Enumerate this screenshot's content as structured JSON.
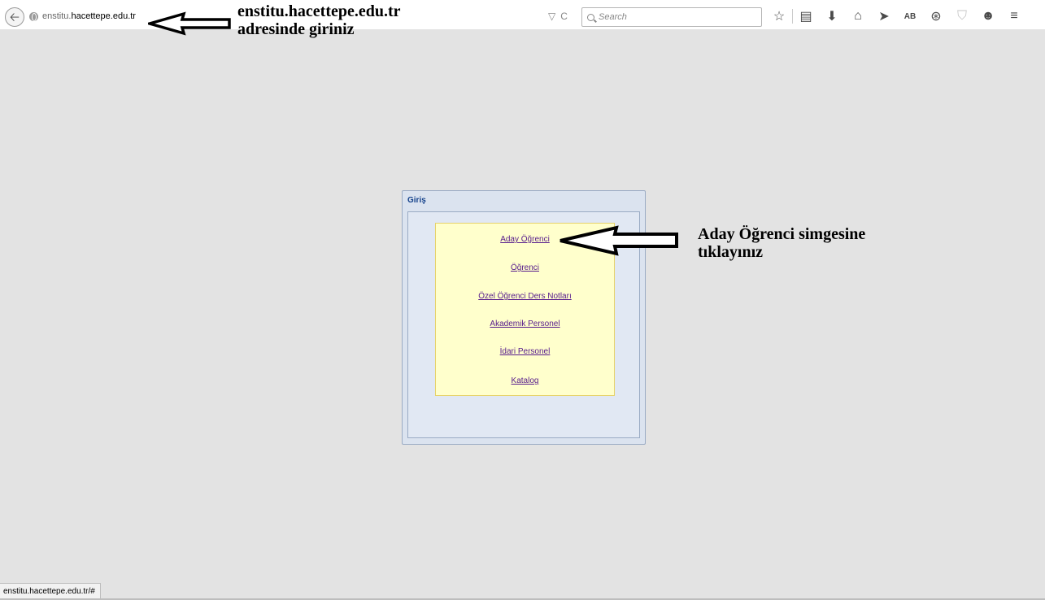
{
  "browser": {
    "url_prefix": "enstitu.",
    "url_host": "hacettepe.edu.tr",
    "search_placeholder": "Search",
    "reader_glyph": "▽",
    "reload_glyph": "C",
    "toolbar_icons": [
      "star-icon",
      "bookmarks-icon",
      "download-icon",
      "home-icon",
      "send-icon",
      "AB",
      "globe-icon",
      "shield-icon",
      "chat-icon",
      "menu-icon"
    ],
    "ab_label": "AB"
  },
  "annotations": {
    "top_line1": "enstitu.hacettepe.edu.tr",
    "top_line2": "adresinde giriniz",
    "right_line1": "Aday Öğrenci simgesine",
    "right_line2": "tıklayınız"
  },
  "panel": {
    "title": "Giriş",
    "links": [
      "Aday Öğrenci",
      "Öğrenci",
      "Özel Öğrenci Ders Notları",
      "Akademik Personel",
      "İdari Personel",
      "Katalog"
    ]
  },
  "status_bar": {
    "text": "enstitu.hacettepe.edu.tr/#"
  },
  "colors": {
    "page_bg": "#e3e3e3",
    "panel_bg": "#dbe3ef",
    "panel_title": "#15428b",
    "menu_bg": "#ffffcc",
    "link": "#551a8b"
  }
}
